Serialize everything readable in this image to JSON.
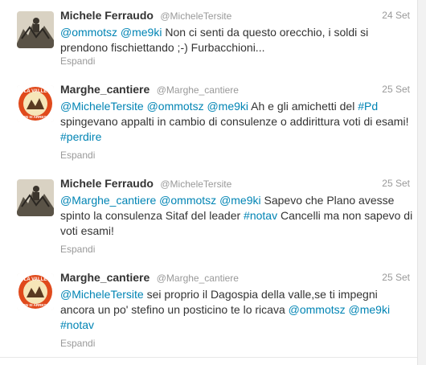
{
  "tweets": [
    {
      "name": "Michele Ferraudo",
      "handle": "@MicheleTersite",
      "time": "24 Set",
      "segments": [
        {
          "t": "@ommotsz",
          "link": true
        },
        {
          "t": " ",
          "link": false
        },
        {
          "t": "@me9ki",
          "link": true
        },
        {
          "t": " Non ci senti da questo orecchio, i soldi si prendono fischiettando ;-) Furbacchioni...",
          "link": false
        }
      ],
      "expand": "Espandi",
      "avatar": "michele-avatar-icon"
    },
    {
      "name": "Marghe_cantiere",
      "handle": "@Marghe_cantiere",
      "time": "25 Set",
      "segments": [
        {
          "t": "@MicheleTersite",
          "link": true
        },
        {
          "t": " ",
          "link": false
        },
        {
          "t": "@ommotsz",
          "link": true
        },
        {
          "t": " ",
          "link": false
        },
        {
          "t": "@me9ki",
          "link": true
        },
        {
          "t": " Ah e gli amichetti del ",
          "link": false
        },
        {
          "t": "#Pd",
          "link": true
        },
        {
          "t": " spingevano appalti in cambio di consulenze o addirittura voti di esami! ",
          "link": false
        },
        {
          "t": "#perdire",
          "link": true
        }
      ],
      "expand": "Espandi",
      "avatar": "la-valle-badge-icon"
    },
    {
      "name": "Michele Ferraudo",
      "handle": "@MicheleTersite",
      "time": "25 Set",
      "segments": [
        {
          "t": "@Marghe_cantiere",
          "link": true
        },
        {
          "t": " ",
          "link": false
        },
        {
          "t": "@ommotsz",
          "link": true
        },
        {
          "t": " ",
          "link": false
        },
        {
          "t": "@me9ki",
          "link": true
        },
        {
          "t": " Sapevo che Plano avesse spinto la consulenza Sitaf del leader ",
          "link": false
        },
        {
          "t": "#notav",
          "link": true
        },
        {
          "t": " Cancelli ma non sapevo di voti esami!",
          "link": false
        }
      ],
      "expand": "Espandi",
      "avatar": "michele-avatar-icon"
    },
    {
      "name": "Marghe_cantiere",
      "handle": "@Marghe_cantiere",
      "time": "25 Set",
      "segments": [
        {
          "t": "@MicheleTersite",
          "link": true
        },
        {
          "t": " sei proprio il Dagospia della valle,se ti impegni ancora un po' stefino un posticino te lo ricava ",
          "link": false
        },
        {
          "t": "@ommotsz",
          "link": true
        },
        {
          "t": " ",
          "link": false
        },
        {
          "t": "@me9ki",
          "link": true
        },
        {
          "t": " ",
          "link": false
        },
        {
          "t": "#notav",
          "link": true
        }
      ],
      "expand": "Espandi",
      "avatar": "la-valle-badge-icon"
    }
  ],
  "badge_text": {
    "top": "LA VALLE",
    "bottom": "NON SI ARRESTA"
  },
  "colors": {
    "link": "#0084b4",
    "muted": "#999999",
    "text": "#333333"
  }
}
